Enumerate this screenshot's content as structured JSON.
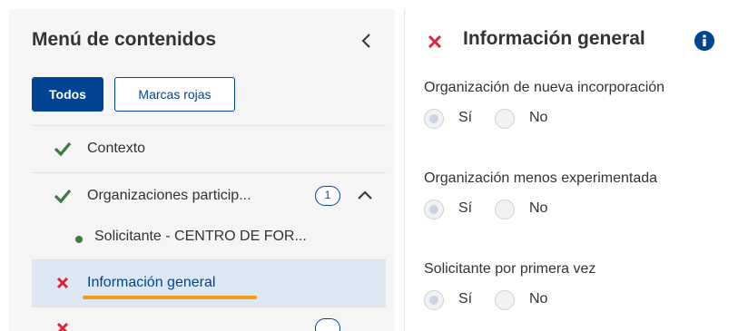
{
  "sidebar": {
    "title": "Menú de contenidos",
    "filters": {
      "all": "Todos",
      "red_marks": "Marcas rojas"
    },
    "items": [
      {
        "label": "Contexto",
        "status": "ok"
      },
      {
        "label": "Organizaciones particip...",
        "status": "ok",
        "badge": "1"
      },
      {
        "label": "Solicitante - CENTRO DE FOR...",
        "status": "ok"
      },
      {
        "label": "Información general",
        "status": "error",
        "active": true
      },
      {
        "label": "",
        "status": "error"
      }
    ]
  },
  "main": {
    "title": "Información general",
    "fields": [
      {
        "label": "Organización de nueva incorporación",
        "options": [
          "Sí",
          "No"
        ],
        "selected": "Sí"
      },
      {
        "label": "Organización menos experimentada",
        "options": [
          "Sí",
          "No"
        ],
        "selected": "Sí"
      },
      {
        "label": "Solicitante por primera vez",
        "options": [
          "Sí",
          "No"
        ],
        "selected": "Sí"
      }
    ]
  },
  "colors": {
    "primary": "#004494",
    "success": "#3d7a3d",
    "error": "#d7263d",
    "highlight": "#f39c12",
    "active_bg": "#dde6f3"
  }
}
